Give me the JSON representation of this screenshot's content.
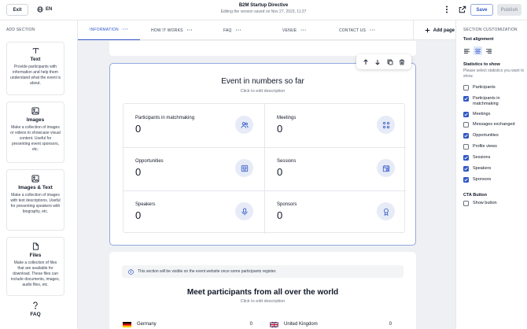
{
  "topbar": {
    "exit_label": "Exit",
    "language": "EN",
    "title": "B2M Startup Directive",
    "subtitle": "Editing the version saved on Nov 27, 2023, 11:27",
    "save_label": "Save",
    "publish_label": "Publish"
  },
  "left_sidebar": {
    "heading": "ADD SECTION",
    "cards": [
      {
        "name": "Text",
        "icon": "text-icon",
        "desc": "Provide participants with information and help them understand what the event is about."
      },
      {
        "name": "Images",
        "icon": "image-icon",
        "desc": "Make a collection of images or videos to showcase visual content. Useful for presenting event sponsors, etc."
      },
      {
        "name": "Images & Text",
        "icon": "image-text-icon",
        "desc": "Make a collection of images with text descriptions. Useful for presenting speakers with biography, etc."
      },
      {
        "name": "Files",
        "icon": "file-icon",
        "desc": "Make a collection of files that are available for download. These files can include documents, images, audio files, etc."
      },
      {
        "name": "FAQ",
        "icon": "question-icon",
        "desc": ""
      }
    ]
  },
  "nav": {
    "tabs": [
      {
        "label": "INFORMATION",
        "active": true
      },
      {
        "label": "HOW IT WORKS",
        "active": false
      },
      {
        "label": "FAQ",
        "active": false
      },
      {
        "label": "VENUE",
        "active": false
      },
      {
        "label": "CONTACT US",
        "active": false
      }
    ],
    "add_page_label": "Add page"
  },
  "stats_section": {
    "title": "Event in numbers so far",
    "description": "Click to edit description",
    "items": [
      {
        "label": "Participants in matchmaking",
        "value": "0",
        "icon": "people-icon"
      },
      {
        "label": "Meetings",
        "value": "0",
        "icon": "grid-dots-icon"
      },
      {
        "label": "Opportunities",
        "value": "0",
        "icon": "opportunity-board-icon"
      },
      {
        "label": "Sessions",
        "value": "0",
        "icon": "calendar-session-icon"
      },
      {
        "label": "Speakers",
        "value": "0",
        "icon": "microphone-icon"
      },
      {
        "label": "Sponsors",
        "value": "0",
        "icon": "award-ribbon-icon"
      }
    ]
  },
  "meet_section": {
    "notice": "This section will be visible on the event website once some participants register.",
    "title": "Meet participants from all over the world",
    "description": "Click to edit description",
    "countries": [
      {
        "name": "Germany",
        "count": "0"
      },
      {
        "name": "United Kingdom",
        "count": "0"
      }
    ]
  },
  "right_sidebar": {
    "heading": "SECTION CUSTOMIZATION",
    "text_alignment_label": "Text alignment",
    "text_alignment_selected": "center",
    "stats_label": "Statistics to show",
    "stats_note": "Please select statistics you want to show.",
    "options": [
      {
        "label": "Participants",
        "checked": false
      },
      {
        "label": "Participants in matchmaking",
        "checked": true
      },
      {
        "label": "Meetings",
        "checked": true
      },
      {
        "label": "Messages exchanged",
        "checked": false
      },
      {
        "label": "Opportunities",
        "checked": true
      },
      {
        "label": "Profile views",
        "checked": false
      },
      {
        "label": "Sessions",
        "checked": true
      },
      {
        "label": "Speakers",
        "checked": true
      },
      {
        "label": "Sponsors",
        "checked": true
      }
    ],
    "cta_label": "CTA Button",
    "cta_option": {
      "label": "Show button",
      "checked": false
    }
  },
  "colors": {
    "accent": "#3157c7",
    "icon_bg": "#e6ebf7"
  }
}
